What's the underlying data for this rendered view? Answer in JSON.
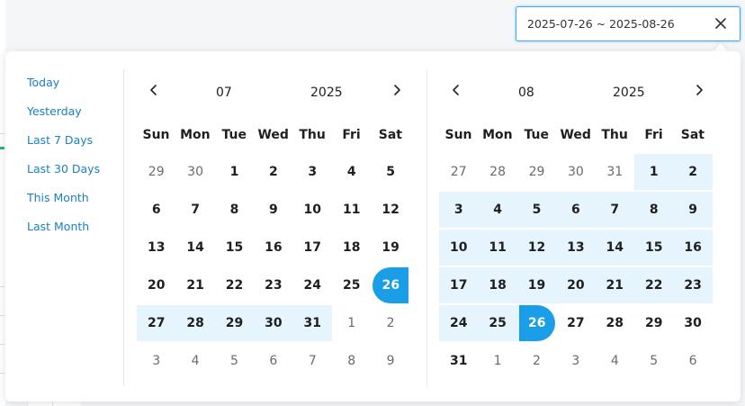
{
  "range_input": {
    "value": "2025-07-26 ~ 2025-08-26"
  },
  "presets": [
    "Today",
    "Yesterday",
    "Last 7 Days",
    "Last 30 Days",
    "This Month",
    "Last Month"
  ],
  "weekdays": [
    "Sun",
    "Mon",
    "Tue",
    "Wed",
    "Thu",
    "Fri",
    "Sat"
  ],
  "months": [
    {
      "month": "07",
      "year": "2025",
      "weeks": [
        [
          "29",
          "30",
          "1",
          "2",
          "3",
          "4",
          "5"
        ],
        [
          "6",
          "7",
          "8",
          "9",
          "10",
          "11",
          "12"
        ],
        [
          "13",
          "14",
          "15",
          "16",
          "17",
          "18",
          "19"
        ],
        [
          "20",
          "21",
          "22",
          "23",
          "24",
          "25",
          "26"
        ],
        [
          "27",
          "28",
          "29",
          "30",
          "31",
          "1",
          "2"
        ],
        [
          "3",
          "4",
          "5",
          "6",
          "7",
          "8",
          "9"
        ]
      ]
    },
    {
      "month": "08",
      "year": "2025",
      "weeks": [
        [
          "27",
          "28",
          "29",
          "30",
          "31",
          "1",
          "2"
        ],
        [
          "3",
          "4",
          "5",
          "6",
          "7",
          "8",
          "9"
        ],
        [
          "10",
          "11",
          "12",
          "13",
          "14",
          "15",
          "16"
        ],
        [
          "17",
          "18",
          "19",
          "20",
          "21",
          "22",
          "23"
        ],
        [
          "24",
          "25",
          "26",
          "27",
          "28",
          "29",
          "30"
        ],
        [
          "31",
          "1",
          "2",
          "3",
          "4",
          "5",
          "6"
        ]
      ]
    }
  ],
  "colors": {
    "accent": "#1b9ee8",
    "range_bg": "#e6f4fd",
    "preset_link": "#1a7fc4"
  },
  "icons": {
    "close": "close-icon",
    "prev": "chevron-left-icon",
    "next": "chevron-right-icon"
  }
}
